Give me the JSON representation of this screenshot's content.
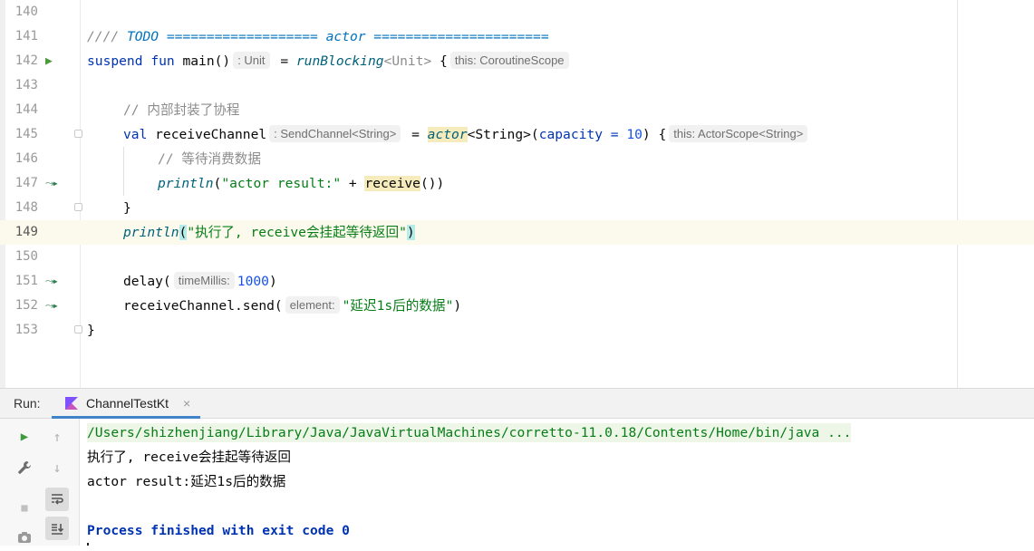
{
  "editor": {
    "lines": [
      {
        "num": "140"
      },
      {
        "num": "141",
        "todo_prefix": "//// ",
        "todo_text": "TODO =================== actor ======================"
      },
      {
        "num": "142",
        "kw_suspend": "suspend",
        "kw_fun": "fun",
        "name": "main()",
        "hint_type": ": Unit",
        "eq": " = ",
        "call": "runBlocking",
        "generic": "<Unit>",
        "brace": " {",
        "hint_scope": "this: CoroutineScope"
      },
      {
        "num": "143"
      },
      {
        "num": "144",
        "comment": "// 内部封装了协程"
      },
      {
        "num": "145",
        "kw_val": "val",
        "var": " receiveChannel",
        "hint_type": ": SendChannel<String>",
        "eq": " = ",
        "call": "actor",
        "generic": "<String>(",
        "param": "capacity = ",
        "value": "10",
        "close": ") {",
        "hint_scope": "this: ActorScope<String>"
      },
      {
        "num": "146",
        "comment": "// 等待消费数据"
      },
      {
        "num": "147",
        "call": "println",
        "open": "(",
        "str": "\"actor result:\"",
        "plus": " + ",
        "recv": "receive",
        "close": "())"
      },
      {
        "num": "148",
        "brace": "}"
      },
      {
        "num": "149",
        "call": "println",
        "open": "(",
        "str": "\"执行了, receive会挂起等待返回\"",
        "close": ")"
      },
      {
        "num": "150"
      },
      {
        "num": "151",
        "call": "delay(",
        "hint": "timeMillis:",
        "value": "1000",
        "close": ")"
      },
      {
        "num": "152",
        "call": "receiveChannel.send(",
        "hint": "element:",
        "str": "\"延迟1s后的数据\"",
        "close": ")"
      },
      {
        "num": "153",
        "brace": "}"
      }
    ]
  },
  "run": {
    "label": "Run:",
    "tab_label": "ChannelTestKt",
    "close_glyph": "×",
    "console": {
      "cmd": "/Users/shizhenjiang/Library/Java/JavaVirtualMachines/corretto-11.0.18/Contents/Home/bin/java ...",
      "out1": "执行了, receive会挂起等待返回",
      "out2": "actor result:延迟1s后的数据",
      "exit": "Process finished with exit code 0"
    }
  },
  "icons": {
    "run_gutter": "run-icon",
    "suspend_gutter": "suspend-call-icon",
    "kotlin_file": "kotlin-icon"
  },
  "colors": {
    "keyword": "#0033b3",
    "string": "#067d17",
    "number": "#1750eb",
    "comment": "#8c8c8c",
    "accent_tab": "#4083c9",
    "current_line": "#fcfaed"
  }
}
